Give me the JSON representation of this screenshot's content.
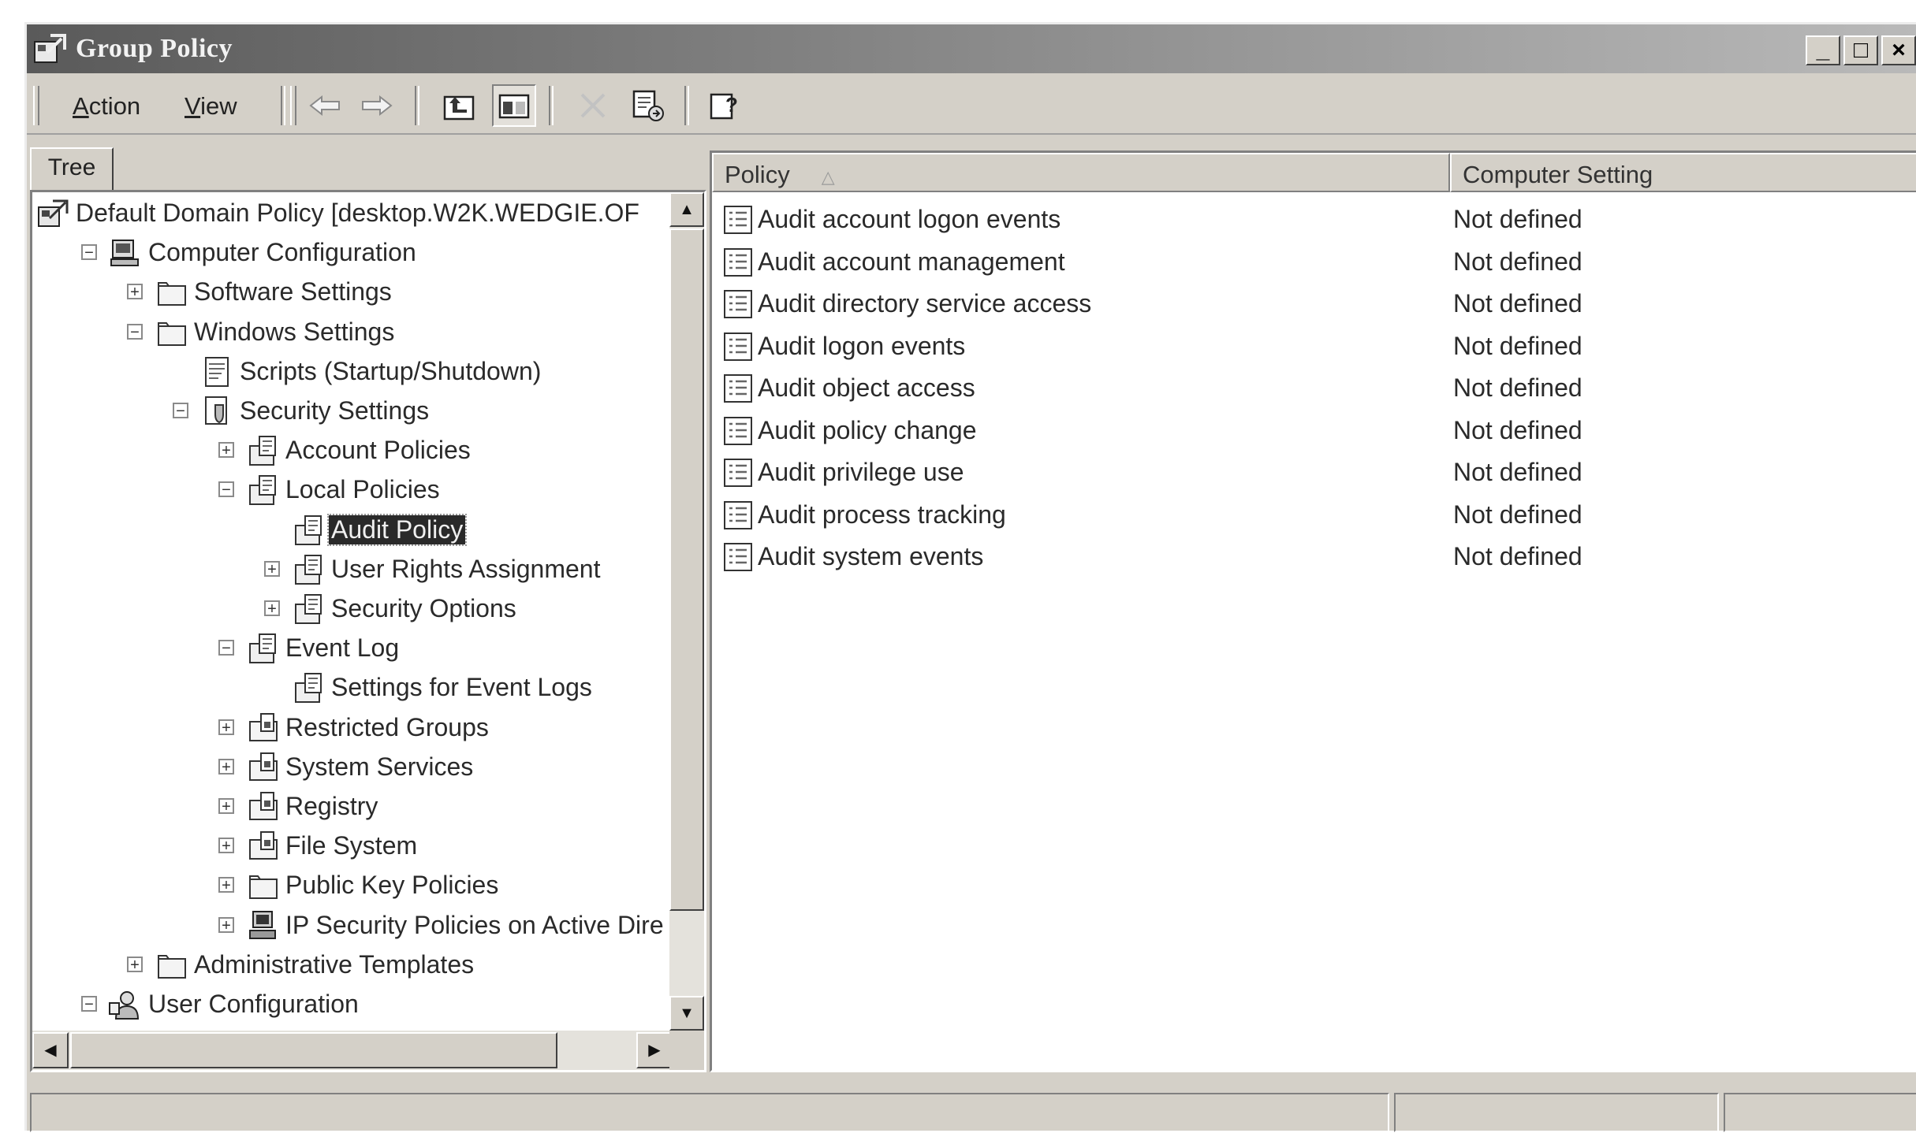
{
  "window": {
    "title": "Group Policy",
    "controls": [
      "minimize",
      "maximize",
      "close"
    ],
    "app_icon": "group-policy-icon"
  },
  "menu": {
    "action": {
      "accel": "A",
      "rest": "ction"
    },
    "view": {
      "accel": "V",
      "rest": "iew"
    }
  },
  "toolbar": {
    "buttons": [
      "back-arrow-icon",
      "forward-arrow-icon",
      "up-one-level-icon",
      "show-hide-console-tree-icon",
      "delete-icon",
      "export-list-icon",
      "help-icon"
    ]
  },
  "tree": {
    "tab_label": "Tree",
    "nodes": [
      {
        "label": "Default Domain Policy [desktop.W2K.WEDGIE.OF",
        "icon": "policy-icon",
        "expander": ""
      },
      {
        "label": "Computer Configuration",
        "icon": "computer-icon",
        "expander": "−"
      },
      {
        "label": "Software Settings",
        "icon": "folder-icon",
        "expander": "+"
      },
      {
        "label": "Windows Settings",
        "icon": "folder-icon",
        "expander": "−"
      },
      {
        "label": "Scripts (Startup/Shutdown)",
        "icon": "script-icon",
        "expander": ""
      },
      {
        "label": "Security Settings",
        "icon": "security-icon",
        "expander": "−"
      },
      {
        "label": "Account Policies",
        "icon": "policy-folder-icon",
        "expander": "+"
      },
      {
        "label": "Local Policies",
        "icon": "policy-folder-icon",
        "expander": "−"
      },
      {
        "label": "Audit Policy",
        "icon": "policy-folder-icon",
        "expander": "",
        "selected": true
      },
      {
        "label": "User Rights Assignment",
        "icon": "policy-folder-icon",
        "expander": "+"
      },
      {
        "label": "Security Options",
        "icon": "policy-folder-icon",
        "expander": "+"
      },
      {
        "label": "Event Log",
        "icon": "policy-folder-icon",
        "expander": "−"
      },
      {
        "label": "Settings for Event Logs",
        "icon": "policy-folder-icon",
        "expander": ""
      },
      {
        "label": "Restricted Groups",
        "icon": "locked-folder-icon",
        "expander": "+"
      },
      {
        "label": "System Services",
        "icon": "locked-folder-icon",
        "expander": "+"
      },
      {
        "label": "Registry",
        "icon": "locked-folder-icon",
        "expander": "+"
      },
      {
        "label": "File System",
        "icon": "locked-folder-icon",
        "expander": "+"
      },
      {
        "label": "Public Key Policies",
        "icon": "folder-icon",
        "expander": "+"
      },
      {
        "label": "IP Security Policies on Active Dire",
        "icon": "network-computer-icon",
        "expander": "+"
      },
      {
        "label": "Administrative Templates",
        "icon": "folder-icon",
        "expander": "+"
      },
      {
        "label": "User Configuration",
        "icon": "user-icon",
        "expander": "−"
      }
    ]
  },
  "list": {
    "columns": [
      "Policy",
      "Computer Setting"
    ],
    "rows": [
      {
        "policy": "Audit account logon events",
        "setting": "Not defined"
      },
      {
        "policy": "Audit account management",
        "setting": "Not defined"
      },
      {
        "policy": "Audit directory service access",
        "setting": "Not defined"
      },
      {
        "policy": "Audit logon events",
        "setting": "Not defined"
      },
      {
        "policy": "Audit object access",
        "setting": "Not defined"
      },
      {
        "policy": "Audit policy change",
        "setting": "Not defined"
      },
      {
        "policy": "Audit privilege use",
        "setting": "Not defined"
      },
      {
        "policy": "Audit process tracking",
        "setting": "Not defined"
      },
      {
        "policy": "Audit system events",
        "setting": "Not defined"
      }
    ]
  },
  "colors": {
    "chrome": "#d4d0c8",
    "title_gradient_start": "#5a5a5a",
    "selection": "#2a2a2a"
  }
}
